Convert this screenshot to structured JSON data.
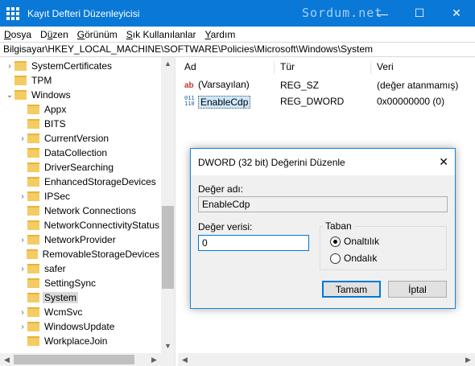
{
  "window": {
    "title": "Kayıt Defteri Düzenleyicisi",
    "watermark": "Sordum.net",
    "minimize": "—",
    "maximize": "☐",
    "close": "✕"
  },
  "menu": [
    "Dosya",
    "Düzen",
    "Görünüm",
    "Sık Kullanılanlar",
    "Yardım"
  ],
  "menu_underline": [
    "D",
    "ü",
    "G",
    "S",
    "Y"
  ],
  "address": "Bilgisayar\\HKEY_LOCAL_MACHINE\\SOFTWARE\\Policies\\Microsoft\\Windows\\System",
  "tree": [
    {
      "label": "SystemCertificates",
      "expander": "›",
      "indent": 1
    },
    {
      "label": "TPM",
      "expander": "",
      "indent": 1
    },
    {
      "label": "Windows",
      "expander": "⌄",
      "indent": 1
    },
    {
      "label": "Appx",
      "expander": "",
      "indent": 2
    },
    {
      "label": "BITS",
      "expander": "",
      "indent": 2
    },
    {
      "label": "CurrentVersion",
      "expander": "›",
      "indent": 2
    },
    {
      "label": "DataCollection",
      "expander": "",
      "indent": 2
    },
    {
      "label": "DriverSearching",
      "expander": "",
      "indent": 2
    },
    {
      "label": "EnhancedStorageDevices",
      "expander": "",
      "indent": 2
    },
    {
      "label": "IPSec",
      "expander": "›",
      "indent": 2
    },
    {
      "label": "Network Connections",
      "expander": "",
      "indent": 2
    },
    {
      "label": "NetworkConnectivityStatus",
      "expander": "",
      "indent": 2
    },
    {
      "label": "NetworkProvider",
      "expander": "›",
      "indent": 2
    },
    {
      "label": "RemovableStorageDevices",
      "expander": "",
      "indent": 2
    },
    {
      "label": "safer",
      "expander": "›",
      "indent": 2
    },
    {
      "label": "SettingSync",
      "expander": "",
      "indent": 2
    },
    {
      "label": "System",
      "expander": "",
      "indent": 2,
      "selected": true
    },
    {
      "label": "WcmSvc",
      "expander": "›",
      "indent": 2
    },
    {
      "label": "WindowsUpdate",
      "expander": "›",
      "indent": 2
    },
    {
      "label": "WorkplaceJoin",
      "expander": "",
      "indent": 2
    }
  ],
  "list": {
    "headers": {
      "name": "Ad",
      "type": "Tür",
      "data": "Veri"
    },
    "rows": [
      {
        "name": "(Varsayılan)",
        "type": "REG_SZ",
        "data": "(değer atanmamış)",
        "icon": "string-value-icon"
      },
      {
        "name": "EnableCdp",
        "type": "REG_DWORD",
        "data": "0x00000000 (0)",
        "icon": "binary-value-icon",
        "selected": true
      }
    ]
  },
  "dialog": {
    "title": "DWORD (32 bit) Değerini Düzenle",
    "close": "✕",
    "name_label": "Değer adı:",
    "name_value": "EnableCdp",
    "data_label": "Değer verisi:",
    "data_value": "0",
    "base_label": "Taban",
    "base_options": [
      {
        "label": "Onaltılık",
        "checked": true
      },
      {
        "label": "Ondalık",
        "checked": false
      }
    ],
    "ok_label": "Tamam",
    "cancel_label": "İptal"
  },
  "colors": {
    "titlebar": "#0a78d7",
    "accent": "#0078d7",
    "folder": "#f3cc63"
  }
}
